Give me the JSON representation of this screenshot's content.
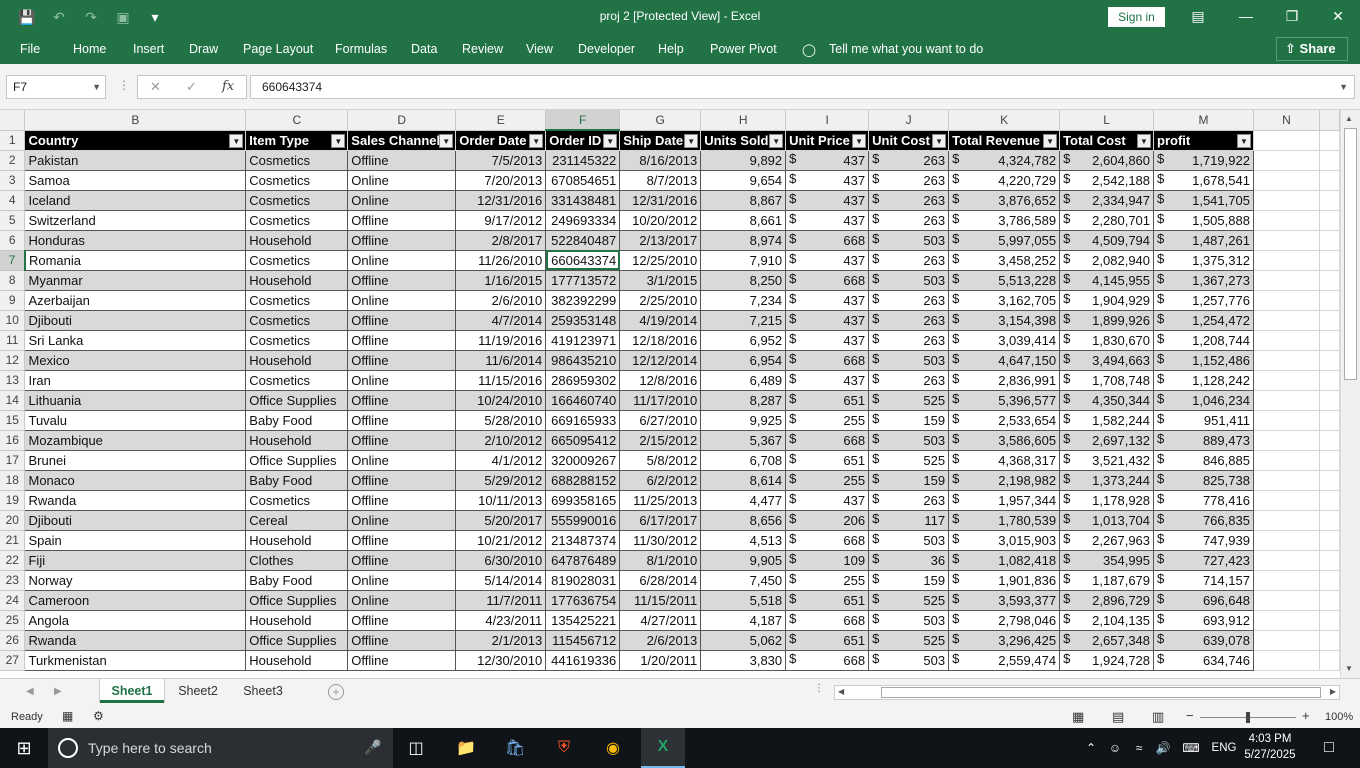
{
  "window": {
    "title": "proj 2  [Protected View]  -  Excel",
    "signin": "Sign in",
    "minimize": "—",
    "restore": "❐",
    "close": "✕"
  },
  "ribbon": {
    "tabs": [
      "File",
      "Home",
      "Insert",
      "Draw",
      "Page Layout",
      "Formulas",
      "Data",
      "Review",
      "View",
      "Developer",
      "Help",
      "Power Pivot"
    ],
    "tellme": "Tell me what you want to do",
    "share": "Share"
  },
  "formula_bar": {
    "name_box": "F7",
    "formula": "660643374"
  },
  "grid": {
    "column_letters": [
      "B",
      "C",
      "D",
      "E",
      "F",
      "G",
      "H",
      "I",
      "J",
      "K",
      "L",
      "M",
      "N"
    ],
    "selected_column": "F",
    "selected_row": 7,
    "headers": [
      "Country",
      "Item Type",
      "Sales Channel",
      "Order Date",
      "Order ID",
      "Ship Date",
      "Units Sold",
      "Unit Price",
      "Unit Cost",
      "Total Revenue",
      "Total Cost",
      "profit"
    ],
    "currency_symbol": "$",
    "rows": [
      [
        "Pakistan",
        "Cosmetics",
        "Offline",
        "7/5/2013",
        "231145322",
        "8/16/2013",
        "9,892",
        "437",
        "263",
        "4,324,782",
        "2,604,860",
        "1,719,922"
      ],
      [
        "Samoa",
        "Cosmetics",
        "Online",
        "7/20/2013",
        "670854651",
        "8/7/2013",
        "9,654",
        "437",
        "263",
        "4,220,729",
        "2,542,188",
        "1,678,541"
      ],
      [
        "Iceland",
        "Cosmetics",
        "Online",
        "12/31/2016",
        "331438481",
        "12/31/2016",
        "8,867",
        "437",
        "263",
        "3,876,652",
        "2,334,947",
        "1,541,705"
      ],
      [
        "Switzerland",
        "Cosmetics",
        "Offline",
        "9/17/2012",
        "249693334",
        "10/20/2012",
        "8,661",
        "437",
        "263",
        "3,786,589",
        "2,280,701",
        "1,505,888"
      ],
      [
        "Honduras",
        "Household",
        "Offline",
        "2/8/2017",
        "522840487",
        "2/13/2017",
        "8,974",
        "668",
        "503",
        "5,997,055",
        "4,509,794",
        "1,487,261"
      ],
      [
        "Romania",
        "Cosmetics",
        "Online",
        "11/26/2010",
        "660643374",
        "12/25/2010",
        "7,910",
        "437",
        "263",
        "3,458,252",
        "2,082,940",
        "1,375,312"
      ],
      [
        "Myanmar",
        "Household",
        "Offline",
        "1/16/2015",
        "177713572",
        "3/1/2015",
        "8,250",
        "668",
        "503",
        "5,513,228",
        "4,145,955",
        "1,367,273"
      ],
      [
        "Azerbaijan",
        "Cosmetics",
        "Online",
        "2/6/2010",
        "382392299",
        "2/25/2010",
        "7,234",
        "437",
        "263",
        "3,162,705",
        "1,904,929",
        "1,257,776"
      ],
      [
        "Djibouti",
        "Cosmetics",
        "Offline",
        "4/7/2014",
        "259353148",
        "4/19/2014",
        "7,215",
        "437",
        "263",
        "3,154,398",
        "1,899,926",
        "1,254,472"
      ],
      [
        "Sri Lanka",
        "Cosmetics",
        "Offline",
        "11/19/2016",
        "419123971",
        "12/18/2016",
        "6,952",
        "437",
        "263",
        "3,039,414",
        "1,830,670",
        "1,208,744"
      ],
      [
        "Mexico",
        "Household",
        "Offline",
        "11/6/2014",
        "986435210",
        "12/12/2014",
        "6,954",
        "668",
        "503",
        "4,647,150",
        "3,494,663",
        "1,152,486"
      ],
      [
        "Iran",
        "Cosmetics",
        "Online",
        "11/15/2016",
        "286959302",
        "12/8/2016",
        "6,489",
        "437",
        "263",
        "2,836,991",
        "1,708,748",
        "1,128,242"
      ],
      [
        "Lithuania",
        "Office Supplies",
        "Offline",
        "10/24/2010",
        "166460740",
        "11/17/2010",
        "8,287",
        "651",
        "525",
        "5,396,577",
        "4,350,344",
        "1,046,234"
      ],
      [
        "Tuvalu",
        "Baby Food",
        "Offline",
        "5/28/2010",
        "669165933",
        "6/27/2010",
        "9,925",
        "255",
        "159",
        "2,533,654",
        "1,582,244",
        "951,411"
      ],
      [
        "Mozambique",
        "Household",
        "Offline",
        "2/10/2012",
        "665095412",
        "2/15/2012",
        "5,367",
        "668",
        "503",
        "3,586,605",
        "2,697,132",
        "889,473"
      ],
      [
        "Brunei",
        "Office Supplies",
        "Online",
        "4/1/2012",
        "320009267",
        "5/8/2012",
        "6,708",
        "651",
        "525",
        "4,368,317",
        "3,521,432",
        "846,885"
      ],
      [
        "Monaco",
        "Baby Food",
        "Offline",
        "5/29/2012",
        "688288152",
        "6/2/2012",
        "8,614",
        "255",
        "159",
        "2,198,982",
        "1,373,244",
        "825,738"
      ],
      [
        "Rwanda",
        "Cosmetics",
        "Offline",
        "10/11/2013",
        "699358165",
        "11/25/2013",
        "4,477",
        "437",
        "263",
        "1,957,344",
        "1,178,928",
        "778,416"
      ],
      [
        "Djibouti",
        "Cereal",
        "Online",
        "5/20/2017",
        "555990016",
        "6/17/2017",
        "8,656",
        "206",
        "117",
        "1,780,539",
        "1,013,704",
        "766,835"
      ],
      [
        "Spain",
        "Household",
        "Offline",
        "10/21/2012",
        "213487374",
        "11/30/2012",
        "4,513",
        "668",
        "503",
        "3,015,903",
        "2,267,963",
        "747,939"
      ],
      [
        "Fiji",
        "Clothes",
        "Offline",
        "6/30/2010",
        "647876489",
        "8/1/2010",
        "9,905",
        "109",
        "36",
        "1,082,418",
        "354,995",
        "727,423"
      ],
      [
        "Norway",
        "Baby Food",
        "Online",
        "5/14/2014",
        "819028031",
        "6/28/2014",
        "7,450",
        "255",
        "159",
        "1,901,836",
        "1,187,679",
        "714,157"
      ],
      [
        "Cameroon",
        "Office Supplies",
        "Online",
        "11/7/2011",
        "177636754",
        "11/15/2011",
        "5,518",
        "651",
        "525",
        "3,593,377",
        "2,896,729",
        "696,648"
      ],
      [
        "Angola",
        "Household",
        "Offline",
        "4/23/2011",
        "135425221",
        "4/27/2011",
        "4,187",
        "668",
        "503",
        "2,798,046",
        "2,104,135",
        "693,912"
      ],
      [
        "Rwanda",
        "Office Supplies",
        "Offline",
        "2/1/2013",
        "115456712",
        "2/6/2013",
        "5,062",
        "651",
        "525",
        "3,296,425",
        "2,657,348",
        "639,078"
      ],
      [
        "Turkmenistan",
        "Household",
        "Offline",
        "12/30/2010",
        "441619336",
        "1/20/2011",
        "3,830",
        "668",
        "503",
        "2,559,474",
        "1,924,728",
        "634,746"
      ]
    ]
  },
  "sheets": {
    "tabs": [
      "Sheet1",
      "Sheet2",
      "Sheet3"
    ],
    "active": "Sheet1"
  },
  "status": {
    "mode": "Ready",
    "zoom": "100%"
  },
  "taskbar": {
    "search_placeholder": "Type here to search",
    "language": "ENG",
    "time": "4:03 PM",
    "date": "5/27/2025"
  },
  "colors": {
    "excel_green": "#217346",
    "header_fill": "#000000",
    "band_fill": "#d9d9d9"
  }
}
